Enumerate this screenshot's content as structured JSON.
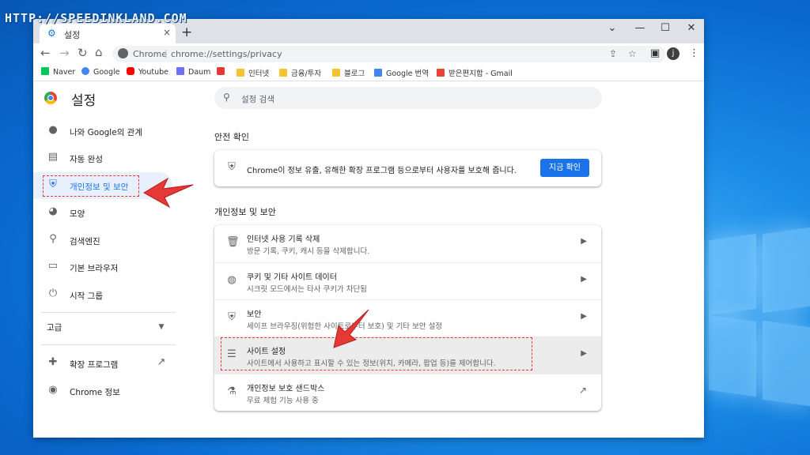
{
  "watermark": "HTTP://SPEEDINKLAND.COM",
  "tab": {
    "title": "설정",
    "close": "×",
    "new_tab": "+"
  },
  "window_controls": {
    "chevron": "⌄",
    "minimize": "—",
    "maximize": "☐",
    "close": "✕"
  },
  "address": {
    "site_label": "Chrome",
    "separator": "|",
    "url": "chrome://settings/privacy"
  },
  "avatar_letter": "j",
  "bookmarks": [
    {
      "label": "Naver",
      "color": "#03c75a"
    },
    {
      "label": "Google",
      "color": "#4285f4"
    },
    {
      "label": "Youtube",
      "color": "#ff0000"
    },
    {
      "label": "Daum",
      "color": "#6f6fff"
    },
    {
      "label": "",
      "color": "#e53935"
    },
    {
      "label": "인터넷",
      "color": "#f4c430"
    },
    {
      "label": "금융/투자",
      "color": "#f4c430"
    },
    {
      "label": "블로그",
      "color": "#f4c430"
    },
    {
      "label": "Google 번역",
      "color": "#4285f4"
    },
    {
      "label": "받은편지함 - Gmail",
      "color": "#ea4335"
    }
  ],
  "sidebar": {
    "title": "설정",
    "items": [
      {
        "label": "나와 Google의 관계",
        "icon": "person-icon"
      },
      {
        "label": "자동 완성",
        "icon": "clipboard-icon"
      },
      {
        "label": "개인정보 및 보안",
        "icon": "shield-icon"
      },
      {
        "label": "모양",
        "icon": "palette-icon"
      },
      {
        "label": "검색엔진",
        "icon": "search-icon"
      },
      {
        "label": "기본 브라우저",
        "icon": "browser-icon"
      },
      {
        "label": "시작 그룹",
        "icon": "power-icon"
      }
    ],
    "advanced": "고급",
    "extensions": "확장 프로그램",
    "about": "Chrome 정보"
  },
  "search": {
    "placeholder": "설정 검색"
  },
  "safety": {
    "heading": "안전 확인",
    "text": "Chrome이 정보 유출, 유해한 확장 프로그램 등으로부터 사용자를 보호해 줍니다.",
    "button": "지금 확인"
  },
  "privacy": {
    "heading": "개인정보 및 보안",
    "rows": [
      {
        "title": "인터넷 사용 기록 삭제",
        "subtitle": "방문 기록, 쿠키, 캐시 등을 삭제합니다."
      },
      {
        "title": "쿠키 및 기타 사이트 데이터",
        "subtitle": "시크릿 모드에서는 타사 쿠키가 차단됨"
      },
      {
        "title": "보안",
        "subtitle": "세이프 브라우징(위험한 사이트로부터 보호) 및 기타 보안 설정"
      },
      {
        "title": "사이트 설정",
        "subtitle": "사이트에서 사용하고 표시할 수 있는 정보(위치, 카메라, 팝업 등)를 제어합니다."
      },
      {
        "title": "개인정보 보호 샌드박스",
        "subtitle": "무료 체험 기능 사용 중"
      }
    ]
  },
  "colors": {
    "accent": "#1a73e8",
    "highlight": "#e53935"
  }
}
